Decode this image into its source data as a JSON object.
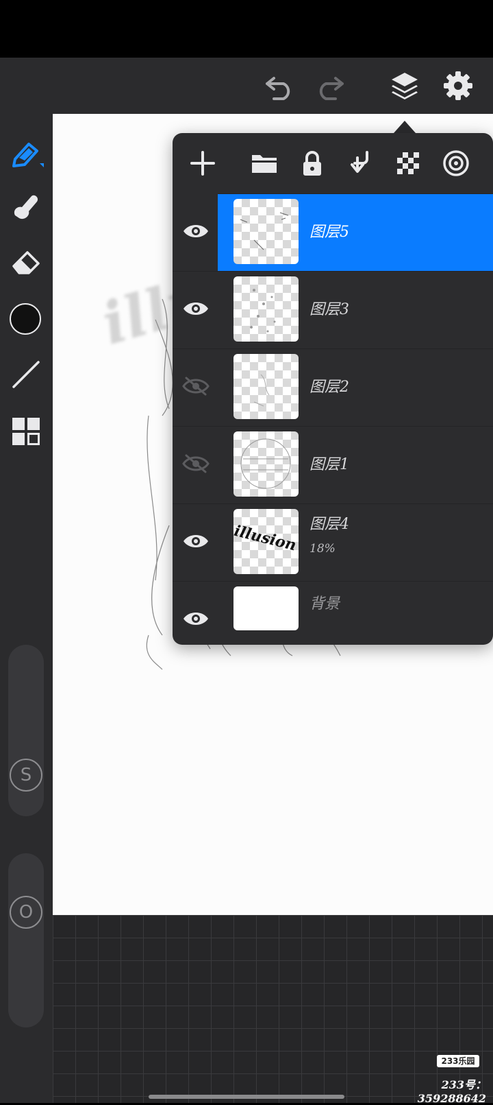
{
  "toolbar": {
    "close": "close-icon",
    "undo": "undo-icon",
    "redo": "redo-icon",
    "layers": "layers-icon",
    "settings": "gear-icon"
  },
  "sidebar": {
    "tools": [
      "pen-icon",
      "smudge-icon",
      "eraser-icon",
      "color-swatch",
      "line-icon",
      "grid-icon"
    ],
    "accent": "#1a8cff",
    "size_slider_label": "S",
    "opacity_slider_label": "O"
  },
  "canvas": {
    "watermark_text": "illusion"
  },
  "layers_panel": {
    "tools": [
      "add-layer-icon",
      "folder-icon",
      "lock-icon",
      "merge-down-icon",
      "alpha-lock-icon",
      "target-icon"
    ],
    "selected_color": "#0a7cff",
    "layers": [
      {
        "name": "图层5",
        "visible": true,
        "selected": true,
        "opacity_label": ""
      },
      {
        "name": "图层3",
        "visible": true,
        "selected": false,
        "opacity_label": ""
      },
      {
        "name": "图层2",
        "visible": false,
        "selected": false,
        "opacity_label": ""
      },
      {
        "name": "图层1",
        "visible": false,
        "selected": false,
        "opacity_label": ""
      },
      {
        "name": "图层4",
        "visible": true,
        "selected": false,
        "opacity_label": "18%"
      },
      {
        "name": "背景",
        "visible": true,
        "selected": false,
        "opacity_label": ""
      }
    ],
    "thumb_text": "illusion"
  },
  "watermark": {
    "badge": "233乐园",
    "text": "233号： 359288642"
  }
}
